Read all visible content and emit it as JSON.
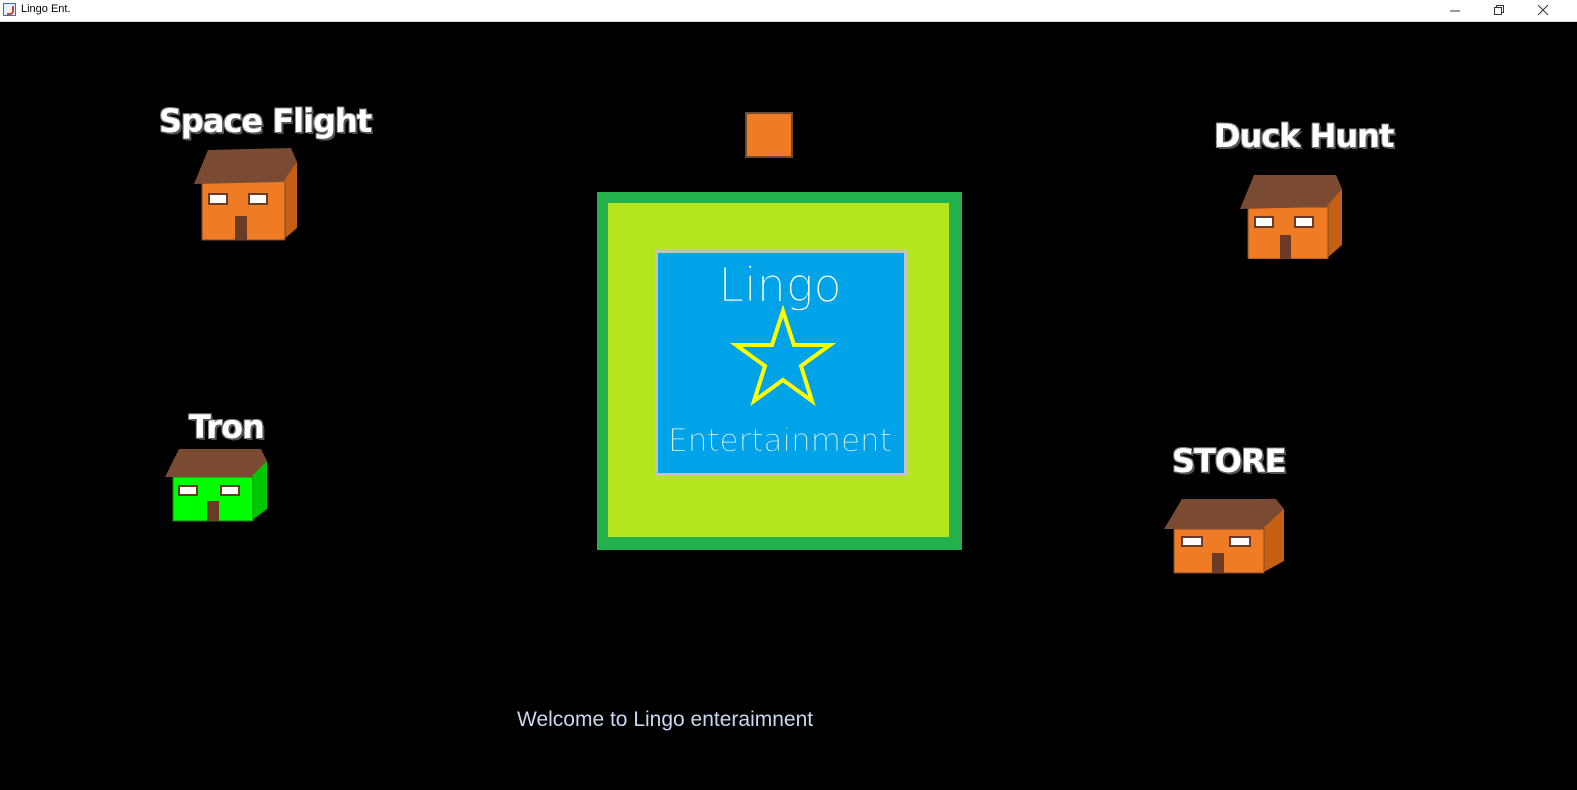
{
  "window": {
    "title": "Lingo Ent.",
    "icons": [
      "java-app-icon",
      "minimize-icon",
      "restore-icon",
      "close-icon"
    ]
  },
  "houses": [
    {
      "label": "Space Flight",
      "color": "#f07b25"
    },
    {
      "label": "Duck Hunt",
      "color": "#f07b25"
    },
    {
      "label": "Tron",
      "color": "#00ff00"
    },
    {
      "label": "STORE",
      "color": "#f07b25"
    }
  ],
  "logo": {
    "top_text": "Lingo",
    "bottom_text": "Entertainment",
    "star_color": "#ffff00",
    "panel_color": "#00a2e8"
  },
  "welcome_text": "Welcome to Lingo enteraimnent",
  "colors": {
    "roof": "#7b4a32",
    "frame_outer": "#22b14c",
    "frame_inner": "#b5e61d",
    "player": "#f07b25"
  }
}
